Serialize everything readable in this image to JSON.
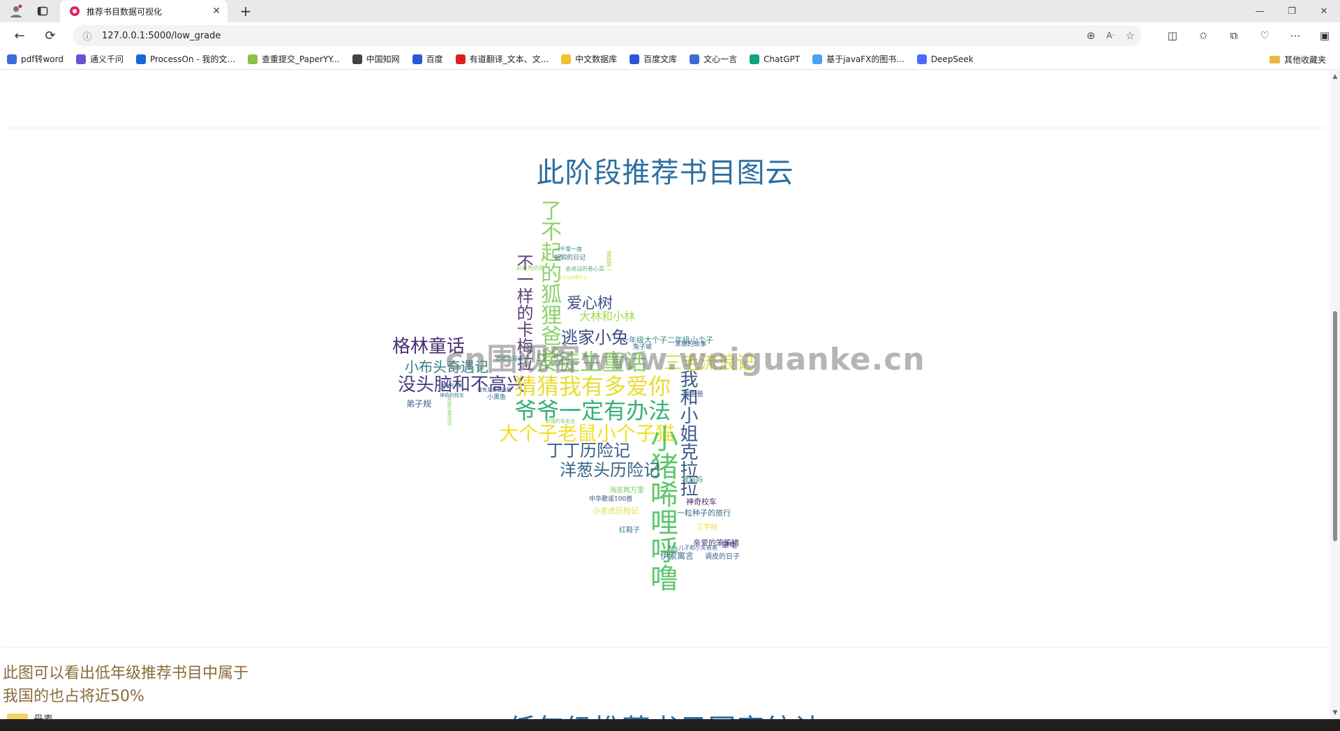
{
  "browser": {
    "tab_title": "推荐书目数据可视化",
    "url": "127.0.0.1:5000/low_grade",
    "bookmarks": [
      {
        "label": "pdf转word",
        "color": "#3a6fd8"
      },
      {
        "label": "通义千问",
        "color": "#6b4fd8"
      },
      {
        "label": "ProcessOn - 我的文...",
        "color": "#1766d6"
      },
      {
        "label": "查重提交_PaperYY...",
        "color": "#8bc34a"
      },
      {
        "label": "中国知网",
        "color": "#444444"
      },
      {
        "label": "百度",
        "color": "#2d55d8"
      },
      {
        "label": "有道翻译_文本、文...",
        "color": "#e02020"
      },
      {
        "label": "中文数据库",
        "color": "#f2c12e"
      },
      {
        "label": "百度文库",
        "color": "#2d55d8"
      },
      {
        "label": "文心一言",
        "color": "#3c6bd8"
      },
      {
        "label": "ChatGPT",
        "color": "#10a37f"
      },
      {
        "label": "基于javaFX的图书...",
        "color": "#4aa3f0"
      },
      {
        "label": "DeepSeek",
        "color": "#4d6bfe"
      }
    ],
    "other_bookmarks": "其他收藏夹"
  },
  "page": {
    "section_title": "此阶段推荐书目图云",
    "watermark": "cn围观客www.weiguanke.cn",
    "note_line1": "此图可以看出低年级推荐书目中属于",
    "note_line2": "我国的也占将近50%",
    "legend_label": "丹麦",
    "next_section_title": "低年级推荐书目国家统计"
  },
  "word_cloud": [
    {
      "text": "了不起的狐狸爸爸",
      "color": "#8fd16b"
    },
    {
      "text": "不一样的卡梅拉",
      "color": "#5b3f7a"
    },
    {
      "text": "爱心树",
      "color": "#3f4f86"
    },
    {
      "text": "逃家小兔",
      "color": "#3d4a86"
    },
    {
      "text": "格林童话",
      "color": "#4a2f72"
    },
    {
      "text": "小布头奇遇记",
      "color": "#2f7e8a"
    },
    {
      "text": "安徒生童话",
      "color": "#8dd26a"
    },
    {
      "text": "三毛流浪记",
      "color": "#d9e23b"
    },
    {
      "text": "没头脑和不高兴",
      "color": "#4b3c7f"
    },
    {
      "text": "猜猜我有多爱你",
      "color": "#e8dd31"
    },
    {
      "text": "爷爷一定有办法",
      "color": "#35b07a"
    },
    {
      "text": "大个子老鼠小个子猫",
      "color": "#f0e027"
    },
    {
      "text": "小猪唏哩呼噜",
      "color": "#5fc66e"
    },
    {
      "text": "我和小姐克拉拉",
      "color": "#3a5a8a"
    },
    {
      "text": "丁丁历险记",
      "color": "#3a5d8a"
    },
    {
      "text": "洋葱头历险记",
      "color": "#33648a"
    },
    {
      "text": "一年级大个子二年级小个子",
      "color": "#3a8a8a"
    },
    {
      "text": "大林和小林",
      "color": "#a6d84a"
    },
    {
      "text": "神奇校车",
      "color": "#4b2f72"
    },
    {
      "text": "一粒种子的旅行",
      "color": "#3a6a8a"
    },
    {
      "text": "弟子规",
      "color": "#3a5a8a"
    },
    {
      "text": "亲爱的笨笨猪",
      "color": "#4a3c7f"
    },
    {
      "text": "伊索寓言",
      "color": "#3a6a8a"
    },
    {
      "text": "调皮的日子",
      "color": "#3a5a8a"
    },
    {
      "text": "中华歌谣100首",
      "color": "#2f4f7a"
    },
    {
      "text": "小老虎历险记",
      "color": "#d9e23b"
    },
    {
      "text": "海底两万里",
      "color": "#7ec96a"
    },
    {
      "text": "三字经",
      "color": "#e8dd31"
    },
    {
      "text": "一千零一夜",
      "color": "#3a8a8a"
    },
    {
      "text": "蚯蚓的日记",
      "color": "#3a6a8a"
    },
    {
      "text": "我爸爸",
      "color": "#3a5a8a"
    },
    {
      "text": "我妈妈",
      "color": "#3a8a6a"
    },
    {
      "text": "红鞋子",
      "color": "#2f7e8a"
    },
    {
      "text": "谁是第一",
      "color": "#a6d84a"
    },
    {
      "text": "兔子坡",
      "color": "#3a5a8a"
    },
    {
      "text": "笨狼的故事",
      "color": "#3a5a8a"
    },
    {
      "text": "小黑鱼",
      "color": "#3a6a8a"
    },
    {
      "text": "犟龟",
      "color": "#4a3c7f"
    },
    {
      "text": "大头儿子和小头爸爸",
      "color": "#3a6a8a"
    },
    {
      "text": "神奇的校车",
      "color": "#2f7e8a"
    },
    {
      "text": "彩虹色的花",
      "color": "#8dd26a"
    },
    {
      "text": "好饿的毛毛虫",
      "color": "#7ec96a"
    },
    {
      "text": "会说话的卷心菜",
      "color": "#5bb07a"
    },
    {
      "text": "长大以后做什么",
      "color": "#d9e23b"
    },
    {
      "text": "我有友情要出租",
      "color": "#3a5a8a"
    },
    {
      "text": "安徒生童话选",
      "color": "#8dd26a"
    },
    {
      "text": "狐狸和乌鸦",
      "color": "#3a6a8a"
    },
    {
      "text": "猜猜我是谁",
      "color": "#3a8a8a"
    }
  ]
}
